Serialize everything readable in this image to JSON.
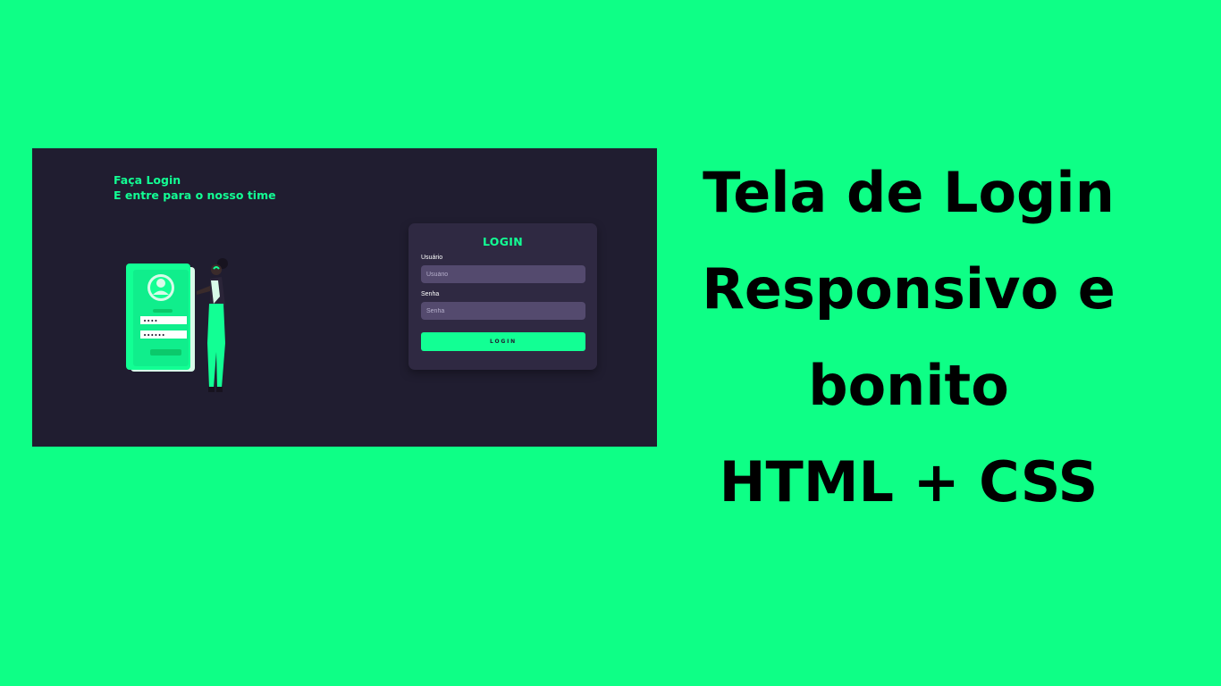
{
  "page": {
    "background_color": "#0eff86"
  },
  "screenshot": {
    "background_color": "#201d30",
    "accent_color": "#12ff94",
    "headline": {
      "line1": "Faça Login",
      "line2": "E entre para o nosso time"
    },
    "illustration": {
      "phone_color": "#12ff94",
      "password_dots_1": "••••",
      "password_dots_2": "••••••"
    },
    "login_card": {
      "background_color": "#2f2942",
      "title": "LOGIN",
      "username": {
        "label": "Usuário",
        "placeholder": "Usuário",
        "value": ""
      },
      "password": {
        "label": "Senha",
        "placeholder": "Senha",
        "value": ""
      },
      "button_label": "LOGIN"
    }
  },
  "title": {
    "line1": "Tela de Login",
    "line2": "Responsivo e",
    "line3": "bonito",
    "line4": "HTML + CSS"
  }
}
